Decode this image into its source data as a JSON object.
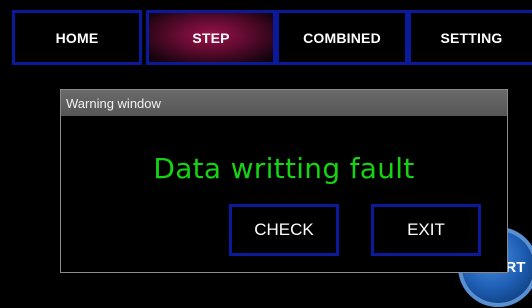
{
  "nav": {
    "tabs": [
      {
        "label": "HOME",
        "active": false
      },
      {
        "label": "STEP",
        "active": true
      },
      {
        "label": "COMBINED",
        "active": false
      },
      {
        "label": "SETTING",
        "active": false
      }
    ]
  },
  "start_button": {
    "label": "START"
  },
  "dialog": {
    "title": "Warning window",
    "message": "Data writting fault",
    "check_label": "CHECK",
    "exit_label": "EXIT"
  },
  "colors": {
    "background": "#000000",
    "tab_border": "#0a1a9a",
    "active_tab": "#9a1248",
    "message_text": "#14d414",
    "dialog_titlebar": "#5f5f5f",
    "start_button": "#1f5fb5"
  }
}
